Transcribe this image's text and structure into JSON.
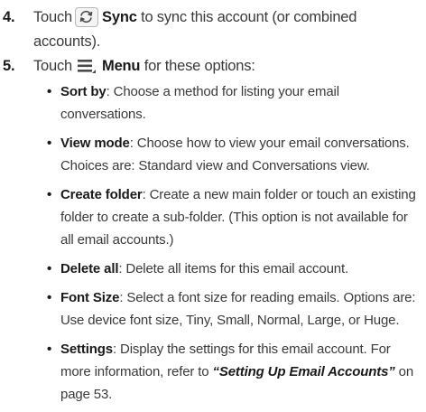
{
  "steps": [
    {
      "number": "4.",
      "pre": "Touch",
      "icon": "sync-icon",
      "label": "Sync",
      "text": "to sync this account (or combined accounts)."
    },
    {
      "number": "5.",
      "pre": "Touch",
      "icon": "menu-icon",
      "label": "Menu",
      "text": "for these options:"
    }
  ],
  "options": [
    {
      "title": "Sort by",
      "text": ": Choose a method for listing your email conversations."
    },
    {
      "title": "View mode",
      "text": ": Choose how to view your email conversations. Choices are: Standard view and Conversations view."
    },
    {
      "title": "Create folder",
      "text": ": Create a new main folder or touch an existing folder to create a sub-folder. (This option is not available for all email accounts.)"
    },
    {
      "title": "Delete all",
      "text": ": Delete all items for this email account."
    },
    {
      "title": "Font Size",
      "text": ": Select a font size for reading emails. Options are: Use device font size, Tiny, Small, Normal, Large, or Huge."
    },
    {
      "title": "Settings",
      "text": ": Display the settings for this email account. For more information, refer to ",
      "link": "“Setting Up Email Accounts”",
      "tail": " on page 53."
    }
  ],
  "colors": {
    "text": "#3a3a3a",
    "bold": "#1a1a1a",
    "icon": "#4a4a4a"
  }
}
